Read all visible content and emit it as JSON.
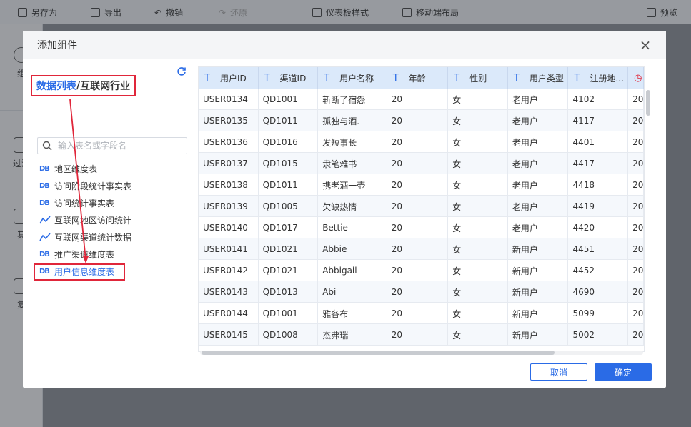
{
  "toolbar": {
    "items": [
      {
        "label": "另存为",
        "icon": "save-icon"
      },
      {
        "label": "导出",
        "icon": "export-icon"
      },
      {
        "label": "撤销",
        "icon": "undo-icon"
      },
      {
        "label": "还原",
        "icon": "redo-icon"
      },
      {
        "label": "仪表板样式",
        "icon": "grid-style-icon"
      },
      {
        "label": "移动端布局",
        "icon": "mobile-icon"
      },
      {
        "label": "预览",
        "icon": "monitor-icon"
      }
    ]
  },
  "rail": {
    "items": [
      {
        "label": "组"
      },
      {
        "label": "过滤"
      },
      {
        "label": "其"
      },
      {
        "label": "复"
      }
    ]
  },
  "dialog": {
    "title": "添加组件",
    "close_icon": "close-icon",
    "breadcrumb": {
      "link": "数据列表",
      "sep": "/",
      "current": "互联网行业"
    },
    "search": {
      "placeholder": "输入表名或字段名"
    },
    "tables": [
      {
        "label": "地区维度表",
        "icon": "db-table-icon"
      },
      {
        "label": "访问阶段统计事实表",
        "icon": "db-table-icon"
      },
      {
        "label": "访问统计事实表",
        "icon": "db-table-icon"
      },
      {
        "label": "互联网地区访问统计",
        "icon": "analysis-table-icon"
      },
      {
        "label": "互联网渠道统计数据",
        "icon": "analysis-table-icon"
      },
      {
        "label": "推广渠道维度表",
        "icon": "db-table-icon"
      },
      {
        "label": "用户信息维度表",
        "icon": "db-table-icon",
        "active": true
      }
    ],
    "grid": {
      "columns": [
        "用户ID",
        "渠道ID",
        "用户名称",
        "年龄",
        "性别",
        "用户类型",
        "注册地..."
      ],
      "rows": [
        [
          "USER0134",
          "QD1001",
          "斩断了宿怨",
          "20",
          "女",
          "老用户",
          "4102",
          "20"
        ],
        [
          "USER0135",
          "QD1011",
          "孤独与酒.",
          "20",
          "女",
          "老用户",
          "4117",
          "20"
        ],
        [
          "USER0136",
          "QD1016",
          "发短事长",
          "20",
          "女",
          "老用户",
          "4401",
          "20"
        ],
        [
          "USER0137",
          "QD1015",
          "隶笔难书",
          "20",
          "女",
          "老用户",
          "4417",
          "20"
        ],
        [
          "USER0138",
          "QD1011",
          "携老酒一壶",
          "20",
          "女",
          "老用户",
          "4418",
          "20"
        ],
        [
          "USER0139",
          "QD1005",
          "欠缺热情",
          "20",
          "女",
          "老用户",
          "4419",
          "20"
        ],
        [
          "USER0140",
          "QD1017",
          "Bettie",
          "20",
          "女",
          "老用户",
          "4420",
          "20"
        ],
        [
          "USER0141",
          "QD1021",
          "Abbie",
          "20",
          "女",
          "新用户",
          "4451",
          "20"
        ],
        [
          "USER0142",
          "QD1021",
          "Abbigail",
          "20",
          "女",
          "新用户",
          "4452",
          "20"
        ],
        [
          "USER0143",
          "QD1013",
          "Abi",
          "20",
          "女",
          "新用户",
          "4690",
          "20"
        ],
        [
          "USER0144",
          "QD1001",
          "雅各布",
          "20",
          "女",
          "新用户",
          "5099",
          "20"
        ],
        [
          "USER0145",
          "QD1008",
          "杰弗瑞",
          "20",
          "女",
          "新用户",
          "5002",
          "20"
        ]
      ]
    },
    "buttons": {
      "cancel": "取消",
      "ok": "确定"
    },
    "colors": {
      "accent": "#2a6be6",
      "highlight": "#e0263a",
      "header_bg": "#dbe9fa"
    }
  }
}
